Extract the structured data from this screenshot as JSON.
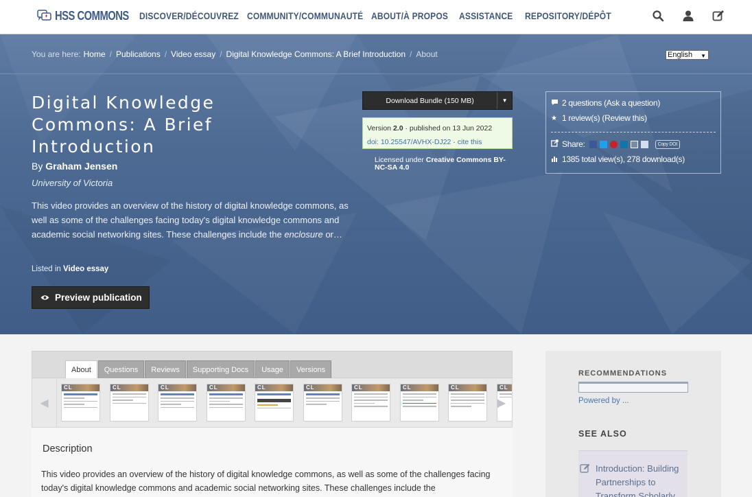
{
  "site": {
    "logo_text": "HSS COMMONS"
  },
  "nav": {
    "items": [
      "DISCOVER/DÉCOUVREZ",
      "COMMUNITY/COMMUNAUTÉ",
      "ABOUT/À PROPOS",
      "ASSISTANCE",
      "REPOSITORY/DÉPÔT"
    ],
    "icons": [
      "search-icon",
      "user-icon",
      "edit-icon"
    ]
  },
  "breadcrumb": {
    "prefix": "You are here:",
    "items": [
      "Home",
      "Publications",
      "Video essay",
      "Digital Knowledge Commons: A Brief Introduction"
    ],
    "current": "About"
  },
  "language": {
    "selected": "English"
  },
  "publication": {
    "title": "Digital Knowledge Commons: A Brief Introduction",
    "by_prefix": "By",
    "author": "Graham Jensen",
    "affiliation": "University of Victoria",
    "abstract_pre": "This video provides an overview of the history of digital knowledge commons, as well as some of the challenges facing today's digital knowledge commons and academic social networking sites. These challenges include the",
    "abstract_em": "enclosure",
    "abstract_post": "or…",
    "listed_prefix": "Listed in",
    "listed_category": "Video essay",
    "preview_label": "Preview publication"
  },
  "download": {
    "label": "Download Bundle (150 MB)"
  },
  "version": {
    "prefix": "Version",
    "number": "2.0",
    "published": "· published on 13 Jun 2022",
    "doi": "doi: 10.25547/AVHX-DJ22",
    "sep": " · ",
    "cite": "cite this"
  },
  "license": {
    "prefix": "Licensed under",
    "name": "Creative Commons BY-NC-SA 4.0"
  },
  "meta": {
    "questions": "2 questions (Ask a question)",
    "reviews": "1 review(s) (Review this)",
    "share_label": "Share:",
    "copy_doi": "Copy DOI",
    "stats": "1385 total view(s), 278 download(s)"
  },
  "tabs": [
    "About",
    "Questions",
    "Reviews",
    "Supporting Docs",
    "Usage",
    "Versions"
  ],
  "description": {
    "heading": "Description",
    "body": "This video provides an overview of the history of digital knowledge commons, as well as some of the challenges facing today's digital knowledge commons and academic social networking sites. These challenges include the"
  },
  "sidebar": {
    "recommendations_label": "RECOMMENDATIONS",
    "powered_by": "Powered by ...",
    "see_also_label": "SEE ALSO",
    "see_also_item": "Introduction: Building Partnerships to Transform Scholarly"
  },
  "colors": {
    "hero": "#4d6a93",
    "nav_text": "#40577a",
    "link": "#3b6fa7"
  }
}
